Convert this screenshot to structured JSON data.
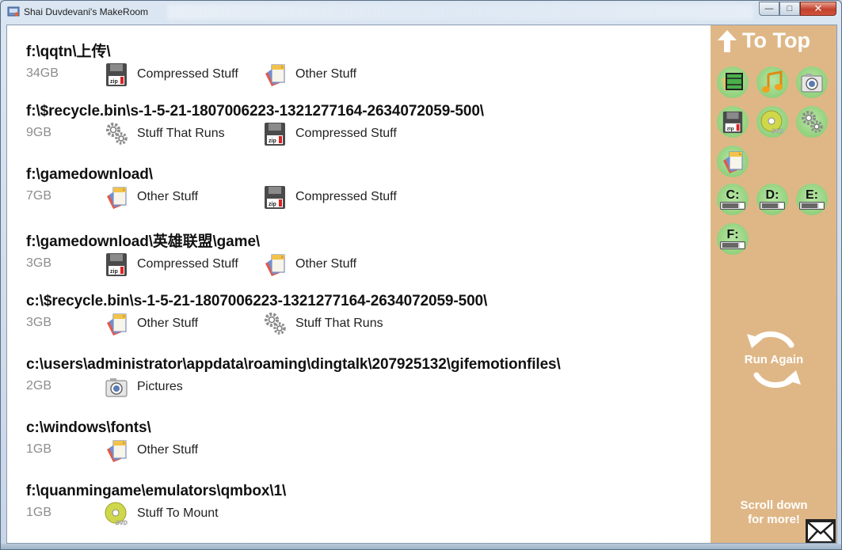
{
  "window": {
    "title": "Shai Duvdevani's MakeRoom",
    "controls": {
      "minimize": "—",
      "maximize": "□",
      "close": "✕"
    }
  },
  "entries": [
    {
      "path": "f:\\qqtn\\上传\\",
      "size": "34GB",
      "categories": [
        {
          "icon": "zip-floppy-icon",
          "label": "Compressed Stuff"
        },
        {
          "icon": "documents-icon",
          "label": "Other Stuff"
        }
      ]
    },
    {
      "path": "f:\\$recycle.bin\\s-1-5-21-1807006223-1321277164-2634072059-500\\",
      "size": "9GB",
      "categories": [
        {
          "icon": "gears-icon",
          "label": "Stuff That Runs"
        },
        {
          "icon": "zip-floppy-icon",
          "label": "Compressed Stuff"
        }
      ]
    },
    {
      "path": "f:\\gamedownload\\",
      "size": "7GB",
      "categories": [
        {
          "icon": "documents-icon",
          "label": "Other Stuff"
        },
        {
          "icon": "zip-floppy-icon",
          "label": "Compressed Stuff"
        }
      ]
    },
    {
      "path": "f:\\gamedownload\\英雄联盟\\game\\",
      "size": "3GB",
      "categories": [
        {
          "icon": "zip-floppy-icon",
          "label": "Compressed Stuff"
        },
        {
          "icon": "documents-icon",
          "label": "Other Stuff"
        }
      ]
    },
    {
      "path": "c:\\$recycle.bin\\s-1-5-21-1807006223-1321277164-2634072059-500\\",
      "size": "3GB",
      "categories": [
        {
          "icon": "documents-icon",
          "label": "Other Stuff"
        },
        {
          "icon": "gears-icon",
          "label": "Stuff That Runs"
        }
      ]
    },
    {
      "path": "c:\\users\\administrator\\appdata\\roaming\\dingtalk\\207925132\\gifemotionfiles\\",
      "size": "2GB",
      "categories": [
        {
          "icon": "camera-icon",
          "label": "Pictures"
        }
      ]
    },
    {
      "path": "c:\\windows\\fonts\\",
      "size": "1GB",
      "categories": [
        {
          "icon": "documents-icon",
          "label": "Other Stuff"
        }
      ]
    },
    {
      "path": "f:\\quanmingame\\emulators\\qmbox\\1\\",
      "size": "1GB",
      "categories": [
        {
          "icon": "dvd-icon",
          "label": "Stuff To Mount"
        }
      ]
    }
  ],
  "sidebar": {
    "to_top": "To Top",
    "filters": [
      "video-icon",
      "music-icon",
      "camera-icon",
      "zip-floppy-icon",
      "dvd-icon",
      "gears-icon",
      "documents-icon"
    ],
    "drives": [
      "C:",
      "D:",
      "E:",
      "F:"
    ],
    "run_again": "Run Again",
    "scroll_hint_line1": "Scroll down",
    "scroll_hint_line2": "for more!"
  },
  "colors": {
    "sidebar_bg": "#dfb787",
    "tile_green": "#9fd98a",
    "size_gray": "#8c8c8c"
  }
}
